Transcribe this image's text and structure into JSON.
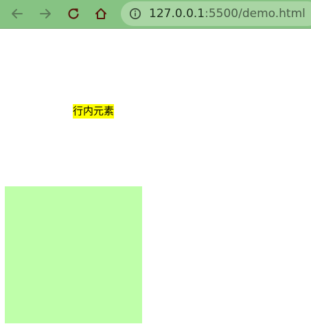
{
  "browser": {
    "url_host": "127.0.0.1",
    "url_rest": ":5500/demo.html",
    "toolbar_color": "#86c383",
    "address_bar_color": "#a9d5a4",
    "icons": {
      "back": "back-arrow-icon",
      "forward": "forward-arrow-icon",
      "reload": "reload-icon",
      "home": "home-icon",
      "site_info": "info-icon"
    }
  },
  "page": {
    "inline_text": "行内元素",
    "inline_bg": "#ffff00",
    "box_color": "#bfffaa"
  }
}
